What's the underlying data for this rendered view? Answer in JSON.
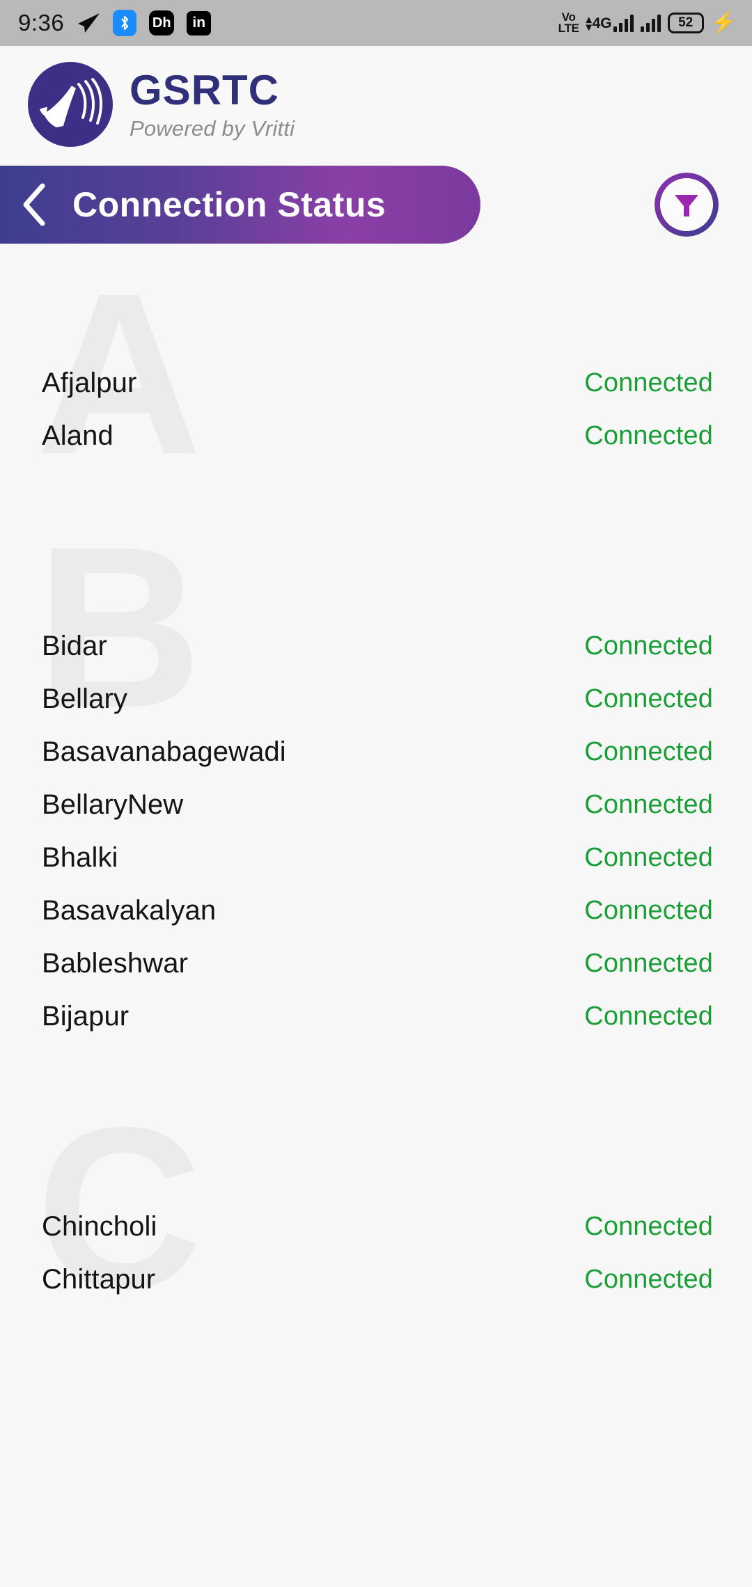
{
  "status_bar": {
    "time": "9:36",
    "icons_left": [
      "telegram-icon",
      "bluetooth-icon",
      "dh-app-icon",
      "linkedin-icon"
    ],
    "dh_label": "Dh",
    "in_label": "in",
    "volte_line1": "Vo",
    "volte_line2": "LTE",
    "network_type": "4G",
    "battery_percent": "52",
    "charging": true
  },
  "header": {
    "brand_name": "GSRTC",
    "brand_subtitle": "Powered by Vritti",
    "logo_icon": "megaphone-icon",
    "brand_color": "#30307a",
    "logo_bg": "#3b2f86"
  },
  "title_bar": {
    "back_icon": "back-chevron-icon",
    "title": "Connection Status",
    "filter_icon": "funnel-filter-icon",
    "gradient_start": "#3d3e8f",
    "gradient_end": "#8a3fa6",
    "filter_accent": "#9b27b0"
  },
  "list": {
    "connected_color": "#1a9e36",
    "groups": [
      {
        "letter": "A",
        "items": [
          {
            "name": "Afjalpur",
            "status": "Connected"
          },
          {
            "name": "Aland",
            "status": "Connected"
          }
        ]
      },
      {
        "letter": "B",
        "items": [
          {
            "name": "Bidar",
            "status": "Connected"
          },
          {
            "name": "Bellary",
            "status": "Connected"
          },
          {
            "name": "Basavanabagewadi",
            "status": "Connected"
          },
          {
            "name": "BellaryNew",
            "status": "Connected"
          },
          {
            "name": "Bhalki",
            "status": "Connected"
          },
          {
            "name": "Basavakalyan",
            "status": "Connected"
          },
          {
            "name": "Bableshwar",
            "status": "Connected"
          },
          {
            "name": "Bijapur",
            "status": "Connected"
          }
        ]
      },
      {
        "letter": "C",
        "items": [
          {
            "name": "Chincholi",
            "status": "Connected"
          },
          {
            "name": "Chittapur",
            "status": "Connected"
          }
        ]
      }
    ]
  }
}
